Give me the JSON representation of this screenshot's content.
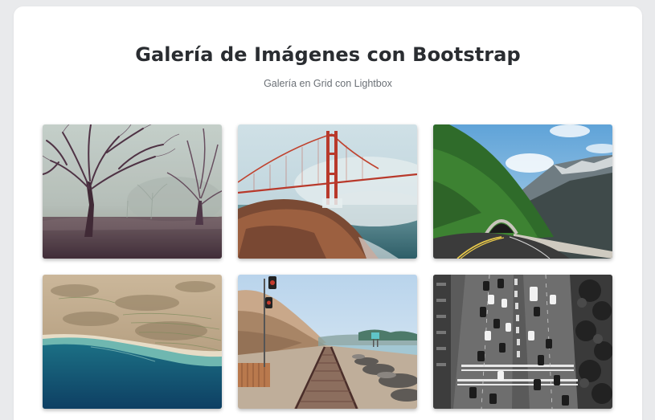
{
  "gallery": {
    "title": "Galería de Imágenes con Bootstrap",
    "subtitle": "Galería en Grid con Lightbox"
  },
  "images": [
    {
      "subject": "foggy-trees"
    },
    {
      "subject": "golden-gate-bridge"
    },
    {
      "subject": "mountain-road-tunnel"
    },
    {
      "subject": "coastal-aerial-view"
    },
    {
      "subject": "railroad-tracks-beach"
    },
    {
      "subject": "city-street-traffic"
    }
  ],
  "colors": {
    "page_background": "#e9eaec",
    "card_background": "#ffffff",
    "title": "#2a2d31",
    "subtitle": "#6b7076"
  }
}
